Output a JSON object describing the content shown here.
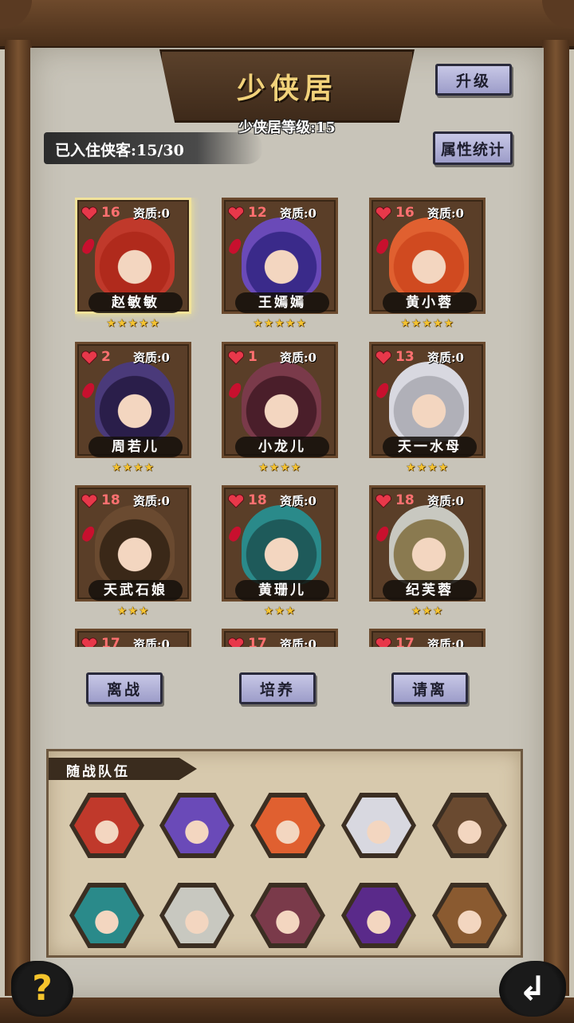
{
  "header": {
    "title": "少侠居",
    "residence_level": "少侠居等级:15",
    "occupancy": "已入住侠客:15/30",
    "upgrade_label": "升级",
    "stats_label": "属性统计"
  },
  "heroes": [
    {
      "name": "赵敏敏",
      "hp": "16",
      "aptitude": "资质:0",
      "stars": "★★★★★",
      "color": "#c0392b",
      "hair": "#b02a1c",
      "selected": true
    },
    {
      "name": "王嫣嫣",
      "hp": "12",
      "aptitude": "资质:0",
      "stars": "★★★★★",
      "color": "#6a4ab8",
      "hair": "#3a2a8a"
    },
    {
      "name": "黄小蓉",
      "hp": "16",
      "aptitude": "资质:0",
      "stars": "★★★★★",
      "color": "#e06030",
      "hair": "#d04a20"
    },
    {
      "name": "周若儿",
      "hp": "2",
      "aptitude": "资质:0",
      "stars": "★★★★",
      "color": "#4a3a7a",
      "hair": "#2a1e4a"
    },
    {
      "name": "小龙儿",
      "hp": "1",
      "aptitude": "资质:0",
      "stars": "★★★★",
      "color": "#7a3a4a",
      "hair": "#4a1e2a"
    },
    {
      "name": "天一水母",
      "hp": "13",
      "aptitude": "资质:0",
      "stars": "★★★★",
      "color": "#d8d8e0",
      "hair": "#b0b0b8"
    },
    {
      "name": "天武石娘",
      "hp": "18",
      "aptitude": "资质:0",
      "stars": "★★★",
      "color": "#6a4a30",
      "hair": "#3a2818"
    },
    {
      "name": "黄珊儿",
      "hp": "18",
      "aptitude": "资质:0",
      "stars": "★★★",
      "color": "#2a8a8a",
      "hair": "#1e5a5a"
    },
    {
      "name": "纪芙蓉",
      "hp": "18",
      "aptitude": "资质:0",
      "stars": "★★★",
      "color": "#c8c8c0",
      "hair": "#8a7a50"
    },
    {
      "name": "",
      "hp": "17",
      "aptitude": "资质:0",
      "stars": "",
      "color": "#6a4a30",
      "hair": "#3a2818"
    },
    {
      "name": "",
      "hp": "17",
      "aptitude": "资质:0",
      "stars": "",
      "color": "#6a4a30",
      "hair": "#3a2818"
    },
    {
      "name": "",
      "hp": "17",
      "aptitude": "资质:0",
      "stars": "",
      "color": "#6a4a30",
      "hair": "#3a2818"
    }
  ],
  "actions": {
    "leave_label": "离战",
    "train_label": "培养",
    "dismiss_label": "请离"
  },
  "team": {
    "header": "随战队伍",
    "members": [
      {
        "color": "#c0392b"
      },
      {
        "color": "#6a4ab8"
      },
      {
        "color": "#e06030"
      },
      {
        "color": "#d8d8e0"
      },
      {
        "color": "#6a4a30"
      },
      {
        "color": "#2a8a8a"
      },
      {
        "color": "#c8c8c0"
      },
      {
        "color": "#7a3a4a"
      },
      {
        "color": "#5a2a8a"
      },
      {
        "color": "#8a5a30"
      }
    ]
  },
  "footer": {
    "help_symbol": "?",
    "return_symbol": "↲"
  }
}
